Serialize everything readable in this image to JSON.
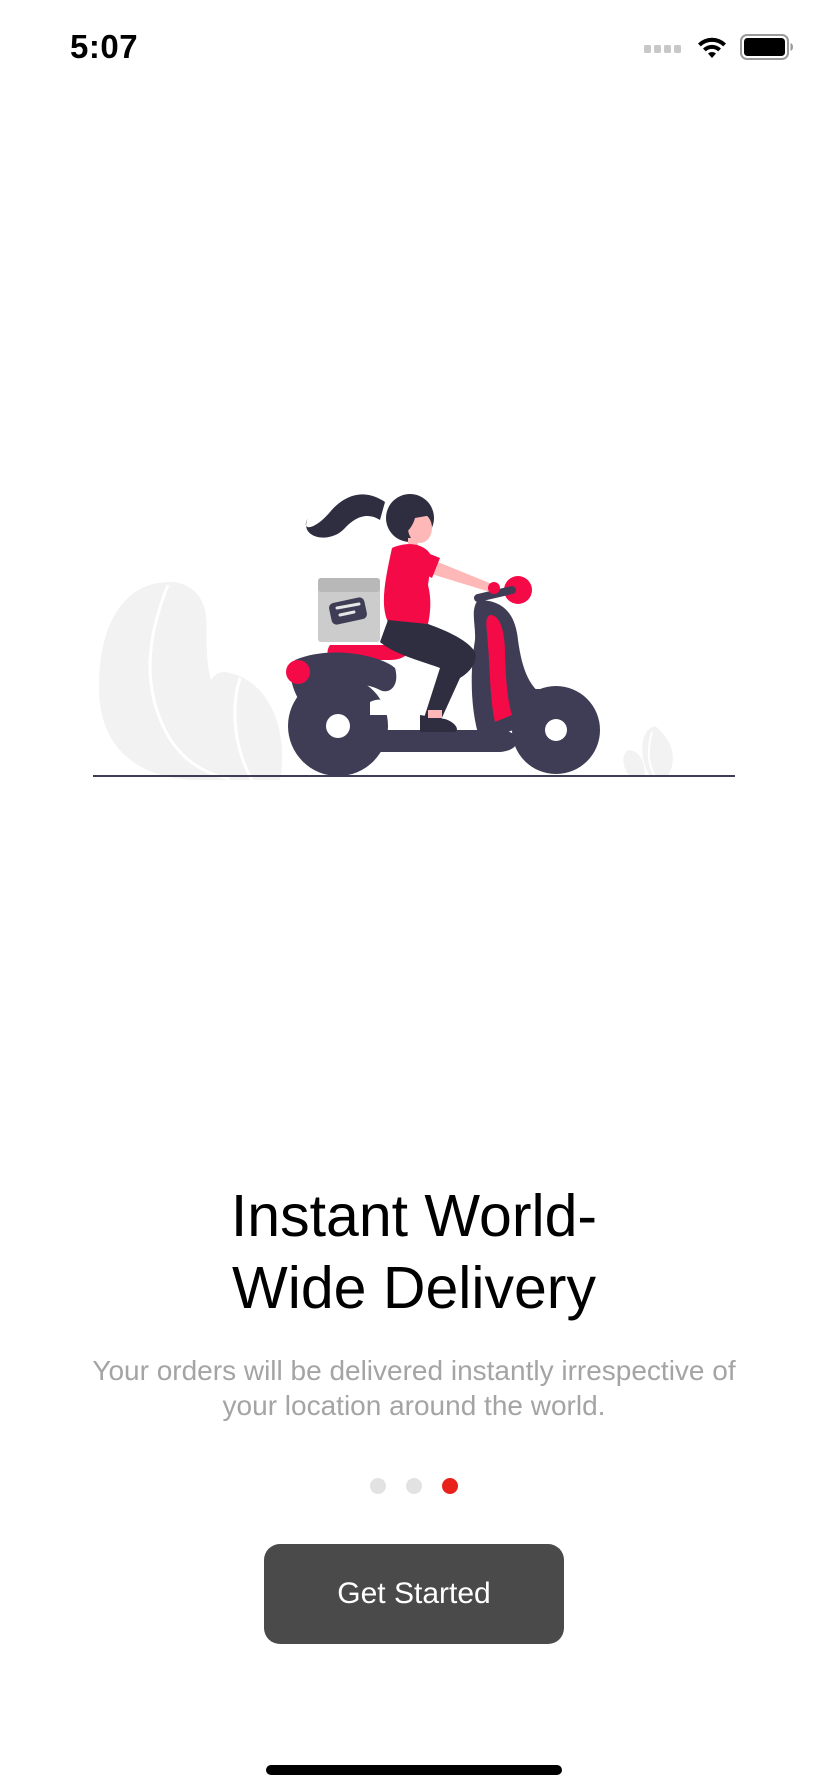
{
  "status_bar": {
    "time": "5:07",
    "icons": [
      "cellular-signal-icon",
      "wifi-icon",
      "battery-icon"
    ]
  },
  "illustration": {
    "subject": "scooter-delivery-illustration",
    "colors": {
      "accent": "#f50a48",
      "dark": "#3f3d56",
      "skin": "#ffb8b8",
      "foliage": "#f2f2f2",
      "box": "#cccccc"
    }
  },
  "onboarding": {
    "headline_line1": "Instant World-",
    "headline_line2": "Wide Delivery",
    "subtitle_line1": "Your orders will be delivered instantly irrespective of",
    "subtitle_line2": "your location around the world.",
    "page_count": 3,
    "active_page": 3,
    "cta_label": "Get Started"
  },
  "colors": {
    "active_dot": "#e8221b",
    "inactive_dot": "#e2e2e2",
    "button_bg": "#4a4a4a",
    "subtitle_text": "#a4a4a4"
  }
}
